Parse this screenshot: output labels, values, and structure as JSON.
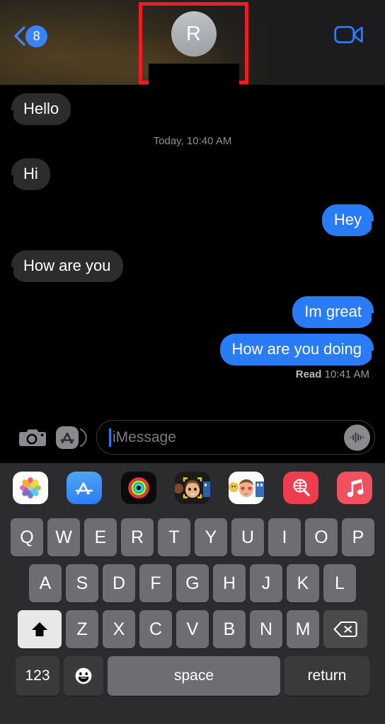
{
  "header": {
    "back_badge_count": "8",
    "back_icon": "chevron-left-icon",
    "contact_initial": "R",
    "contact_name": "",
    "facetime_icon": "video-camera-icon",
    "annotation_color": "#ee1d24"
  },
  "conversation": {
    "timestamp_divider": "Today, 10:40 AM",
    "messages": [
      {
        "text": "Hello",
        "side": "received"
      },
      {
        "text": "Hi",
        "side": "received"
      },
      {
        "text": "Hey",
        "side": "sent"
      },
      {
        "text": "How are you",
        "side": "received"
      },
      {
        "text": "Im great",
        "side": "sent"
      },
      {
        "text": "How are you doing",
        "side": "sent"
      }
    ],
    "read_receipt": {
      "label": "Read",
      "time": "10:41 AM"
    },
    "bubble_colors": {
      "received": "#2c2c2e",
      "sent": "#2a7bf6"
    }
  },
  "input_bar": {
    "camera_icon": "camera-icon",
    "appstore_icon": "app-store-icon",
    "placeholder": "iMessage",
    "value": "",
    "audio_icon": "audio-waveform-icon"
  },
  "app_drawer": {
    "apps": [
      {
        "name": "photos-app-icon",
        "label": "Photos"
      },
      {
        "name": "app-store-app-icon",
        "label": "App Store"
      },
      {
        "name": "activity-app-icon",
        "label": "Activity"
      },
      {
        "name": "memoji-app-icon",
        "label": "Memoji"
      },
      {
        "name": "stickers-app-icon",
        "label": "Stickers"
      },
      {
        "name": "images-app-icon",
        "label": "#images"
      },
      {
        "name": "music-app-icon",
        "label": "Music"
      }
    ]
  },
  "keyboard": {
    "row1": [
      "Q",
      "W",
      "E",
      "R",
      "T",
      "Y",
      "U",
      "I",
      "O",
      "P"
    ],
    "row2": [
      "A",
      "S",
      "D",
      "F",
      "G",
      "H",
      "J",
      "K",
      "L"
    ],
    "row3": [
      "Z",
      "X",
      "C",
      "V",
      "B",
      "N",
      "M"
    ],
    "shift_icon": "shift-up-arrow-icon",
    "backspace_icon": "backspace-delete-icon",
    "numbers_key": "123",
    "emoji_key_icon": "smiley-face-icon",
    "space_key": "space",
    "return_key": "return"
  }
}
